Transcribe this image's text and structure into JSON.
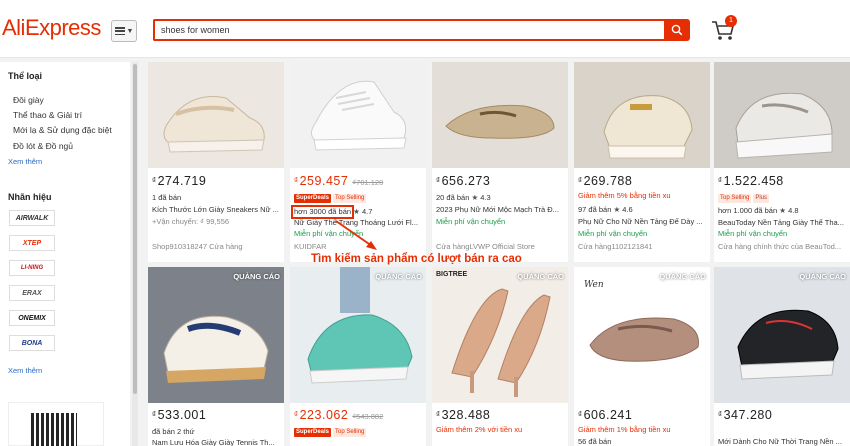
{
  "header": {
    "logo": "AliExpress",
    "search_value": "shoes for women",
    "cart_count": "1"
  },
  "sidebar": {
    "category_title": "Thể loại",
    "categories": [
      "Đôi giày",
      "Thể thao & Giải trí",
      "Mới lạ & Sử dụng đặc biệt",
      "Đồ lót & Đồ ngủ"
    ],
    "more1": "Xem thêm",
    "brand_title": "Nhãn hiệu",
    "brands": [
      "AIRWALK",
      "XTEP",
      "LI-NING",
      "ERAX",
      "ONEMIX",
      "BONA"
    ],
    "more2": "Xem thêm"
  },
  "annotation": "Tìm kiếm sản phẩm có lượt bán ra cao",
  "currency": "₫",
  "row1": [
    {
      "price": "274.719",
      "l1": "1 đã bán",
      "l2": "Kích Thước Lớn Giày Sneakers Nữ ...",
      "l3": "+Vận chuyển: ₫ 99,556",
      "l4": "Shop910318247 Cửa hàng"
    },
    {
      "price": "259.457",
      "old": "₫701.120",
      "b1": "SuperDeals",
      "b2": "Top Selling",
      "sold": "hơn 3000 đã bán",
      "rating": "4.7",
      "l2": "Nữ Giày Thể Trang Thoáng Lưới Fl...",
      "l3": "Miễn phí vận chuyển",
      "l4": "KUIDFAR"
    },
    {
      "price": "656.273",
      "l1": "20 đã bán",
      "rating": "4.3",
      "l2": "2023 Phụ Nữ Mới Mộc Mạch Trà Đ...",
      "l3": "Miễn phí vận chuyển",
      "l4": "Cửa hàngLVWP Official Store"
    },
    {
      "price": "269.788",
      "l1": "Giảm thêm 5% bằng tiền xu",
      "l2a": "97 đã bán",
      "rating": "4.6",
      "l2": "Phụ Nữ Cho Nữ Nền Tảng Đế Dày ...",
      "l3": "Miễn phí vận chuyển",
      "l4": "Cửa hàng1102121841"
    },
    {
      "price": "1.522.458",
      "b1": "Top Selling",
      "b2": "Plus",
      "l1": "hơn 1.000 đã bán",
      "rating": "4.8",
      "l2": "BeauToday Nền Tảng Giày Thể Tha...",
      "l3": "Miễn phí vận chuyển",
      "l4": "Cửa hàng chính thức của BeauTod..."
    }
  ],
  "row2": [
    {
      "ad": "QUẢNG CÁO",
      "price": "533.001",
      "l1": "đã bán 2 thứ",
      "l2": "Nam Lưu Hóa Giày Giày Tennis Th..."
    },
    {
      "ad": "QUẢNG CÁO",
      "price": "223.062",
      "old": "₫543.882",
      "b1": "SuperDeals",
      "b2": "Top Selling"
    },
    {
      "ad": "QUẢNG CÁO",
      "brand": "BIGTREE",
      "price": "328.488",
      "l1": "Giảm thêm 2% với tiền xu"
    },
    {
      "ad": "QUẢNG CÁO",
      "price": "606.241",
      "l1": "Giảm thêm 1% bằng tiền xu",
      "l2a": "56 đã bán"
    },
    {
      "ad": "QUẢNG CÁO",
      "price": "347.280",
      "l1": "Mới Dành Cho Nữ Thời Trang Nền ..."
    }
  ]
}
